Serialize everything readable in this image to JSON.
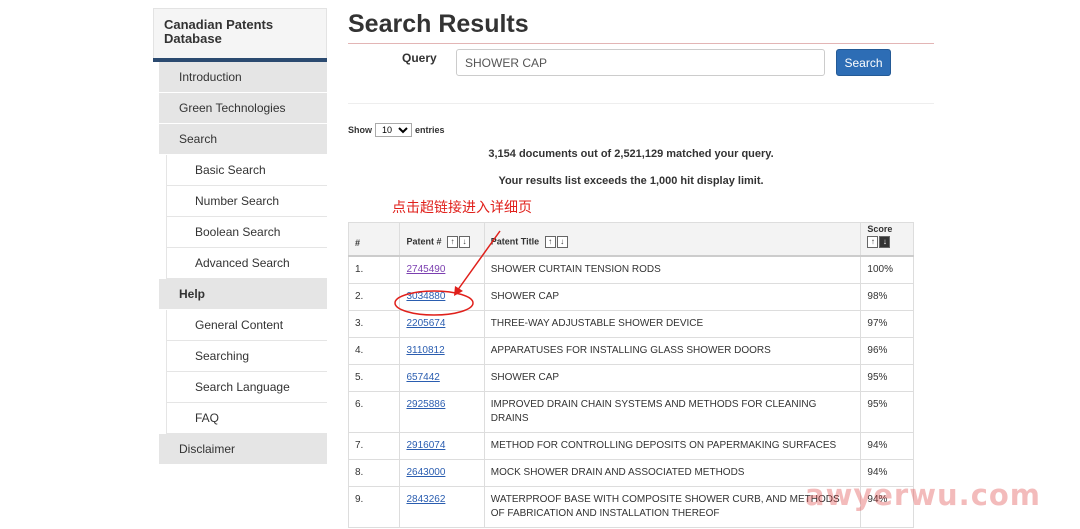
{
  "sidebar": {
    "title": "Canadian Patents Database",
    "items": [
      {
        "label": "Introduction"
      },
      {
        "label": "Green Technologies"
      },
      {
        "label": "Search"
      },
      {
        "label": "Basic Search"
      },
      {
        "label": "Number Search"
      },
      {
        "label": "Boolean Search"
      },
      {
        "label": "Advanced Search"
      },
      {
        "label": "Help"
      },
      {
        "label": "General Content"
      },
      {
        "label": "Searching"
      },
      {
        "label": "Search Language"
      },
      {
        "label": "FAQ"
      },
      {
        "label": "Disclaimer"
      }
    ]
  },
  "main": {
    "title": "Search Results",
    "query_label": "Query",
    "query_value": "SHOWER CAP",
    "search_button": "Search",
    "show_prefix": "Show",
    "show_value": "10",
    "show_suffix": "entries",
    "match_message": "3,154 documents out of 2,521,129 matched your query.",
    "limit_message": "Your results list exceeds the 1,000 hit display limit."
  },
  "annotation": {
    "text": "点击超链接进入详细页",
    "color": "#e0201b"
  },
  "table": {
    "headers": {
      "num": "#",
      "patent": "Patent #",
      "title": "Patent Title",
      "score": "Score"
    },
    "rows": [
      {
        "num": "1.",
        "patent": "2745490",
        "title": "SHOWER CURTAIN TENSION RODS",
        "score": "100%"
      },
      {
        "num": "2.",
        "patent": "3034880",
        "title": "SHOWER CAP",
        "score": "98%"
      },
      {
        "num": "3.",
        "patent": "2205674",
        "title": "THREE-WAY ADJUSTABLE SHOWER DEVICE",
        "score": "97%"
      },
      {
        "num": "4.",
        "patent": "3110812",
        "title": "APPARATUSES FOR INSTALLING GLASS SHOWER DOORS",
        "score": "96%"
      },
      {
        "num": "5.",
        "patent": "657442",
        "title": "SHOWER CAP",
        "score": "95%"
      },
      {
        "num": "6.",
        "patent": "2925886",
        "title": "IMPROVED DRAIN CHAIN SYSTEMS AND METHODS FOR CLEANING DRAINS",
        "score": "95%"
      },
      {
        "num": "7.",
        "patent": "2916074",
        "title": "METHOD FOR CONTROLLING DEPOSITS ON PAPERMAKING SURFACES",
        "score": "94%"
      },
      {
        "num": "8.",
        "patent": "2643000",
        "title": "MOCK SHOWER DRAIN AND ASSOCIATED METHODS",
        "score": "94%"
      },
      {
        "num": "9.",
        "patent": "2843262",
        "title": "WATERPROOF BASE WITH COMPOSITE SHOWER CURB, AND METHODS OF FABRICATION AND INSTALLATION THEREOF",
        "score": "94%"
      }
    ]
  },
  "watermark": "awyerwu.com",
  "colors": {
    "accent": "#2d6db5",
    "sidebar_bar": "#2b4a70",
    "link": "#2a5db0",
    "visited_link": "#7b3fb0"
  }
}
